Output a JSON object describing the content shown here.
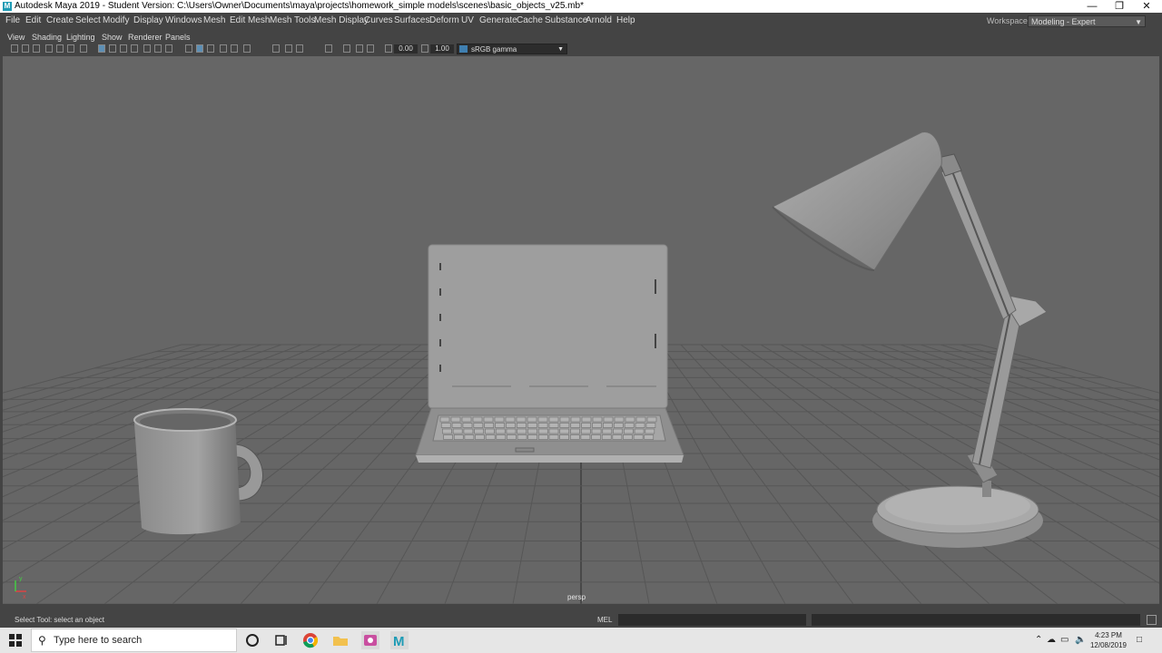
{
  "window": {
    "title": "Autodesk Maya 2019 - Student Version: C:\\Users\\Owner\\Documents\\maya\\projects\\homework_simple models\\scenes\\basic_objects_v25.mb*",
    "app_icon": "maya-icon",
    "controls": [
      "minimize-icon",
      "restore-icon",
      "close-icon"
    ]
  },
  "menu": [
    "File",
    "Edit",
    "Create",
    "Select",
    "Modify",
    "Display",
    "Windows",
    "Mesh",
    "Edit Mesh",
    "Mesh Tools",
    "Mesh Display",
    "Curves",
    "Surfaces",
    "Deform",
    "UV",
    "Generate",
    "Cache",
    "Substance",
    "Arnold",
    "Help"
  ],
  "workspace": {
    "label": "Workspace :",
    "value": "Modeling - Expert"
  },
  "panel_menu": [
    "View",
    "Shading",
    "Lighting",
    "Show",
    "Renderer",
    "Panels"
  ],
  "toolbar": {
    "exposure": "0.00",
    "gamma": "1.00",
    "color_space": "sRGB gamma"
  },
  "viewport": {
    "camera_label": "persp",
    "axis_labels": {
      "x": "x",
      "y": "y"
    }
  },
  "status": {
    "message": "Select Tool: select an object",
    "command_type": "MEL"
  },
  "taskbar": {
    "search_placeholder": "Type here to search",
    "time": "4:23 PM",
    "date": "12/08/2019",
    "apps": [
      "task-view-icon",
      "chrome-icon",
      "file-explorer-icon",
      "snipping-icon",
      "maya-icon"
    ]
  }
}
